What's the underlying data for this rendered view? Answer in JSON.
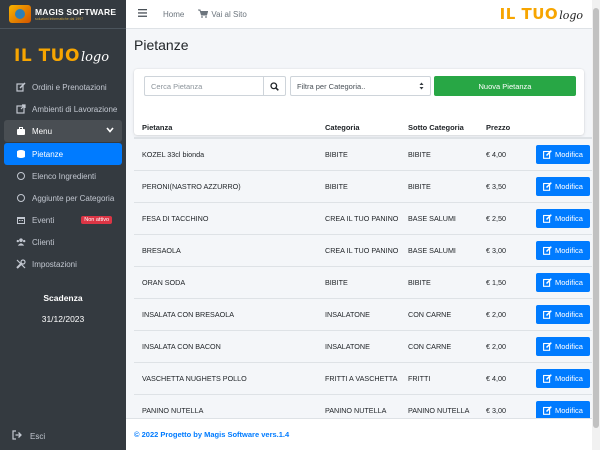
{
  "brand": {
    "title": "MAGIS SOFTWARE",
    "subtitle": "soluzioni informatiche dal 1997"
  },
  "logo": {
    "main": "IL TUO",
    "script": "logo"
  },
  "sidebar": {
    "items": [
      {
        "label": "Ordini e Prenotazioni",
        "icon": "edit-icon"
      },
      {
        "label": "Ambienti di Lavorazione",
        "icon": "external-link-icon"
      },
      {
        "label": "Menu",
        "icon": "briefcase-icon"
      },
      {
        "label": "Pietanze",
        "icon": "database-icon"
      },
      {
        "label": "Elenco Ingredienti",
        "icon": "circle-icon"
      },
      {
        "label": "Aggiunte per Categoria",
        "icon": "circle-icon"
      },
      {
        "label": "Eventi",
        "icon": "calendar-icon",
        "badge": "Non attivo"
      },
      {
        "label": "Clienti",
        "icon": "users-icon"
      },
      {
        "label": "Impostazioni",
        "icon": "tools-icon"
      }
    ],
    "deadline_label": "Scadenza",
    "deadline_date": "31/12/2023",
    "logout_label": "Esci"
  },
  "header": {
    "home_label": "Home",
    "site_label": "Vai al Sito"
  },
  "page": {
    "title": "Pietanze",
    "search_placeholder": "Cerca Pietanza",
    "filter_label": "Filtra per Categoria..",
    "new_button": "Nuova Pietanza"
  },
  "table": {
    "headers": [
      "Pietanza",
      "Categoria",
      "Sotto Categoria",
      "Prezzo"
    ],
    "edit_label": "Modifica",
    "rows": [
      {
        "name": "KOZEL 33cl bionda",
        "category": "BIBITE",
        "subcategory": "BIBITE",
        "price": "€ 4,00"
      },
      {
        "name": "PERONI(NASTRO AZZURRO)",
        "category": "BIBITE",
        "subcategory": "BIBITE",
        "price": "€ 3,50"
      },
      {
        "name": "FESA DI TACCHINO",
        "category": "CREA IL TUO PANINO",
        "subcategory": "BASE SALUMI",
        "price": "€ 2,50"
      },
      {
        "name": "BRESAOLA",
        "category": "CREA IL TUO PANINO",
        "subcategory": "BASE SALUMI",
        "price": "€ 3,00"
      },
      {
        "name": "ORAN SODA",
        "category": "BIBITE",
        "subcategory": "BIBITE",
        "price": "€ 1,50"
      },
      {
        "name": "INSALATA CON BRESAOLA",
        "category": "INSALATONE",
        "subcategory": "CON CARNE",
        "price": "€ 2,00"
      },
      {
        "name": "INSALATA CON BACON",
        "category": "INSALATONE",
        "subcategory": "CON CARNE",
        "price": "€ 2,00"
      },
      {
        "name": "VASCHETTA NUGHETS POLLO",
        "category": "FRITTI A VASCHETTA",
        "subcategory": "FRITTI",
        "price": "€ 4,00"
      },
      {
        "name": "PANINO NUTELLA",
        "category": "PANINO NUTELLA",
        "subcategory": "PANINO NUTELLA",
        "price": "€ 3,00"
      }
    ]
  },
  "footer": {
    "text": "© 2022 Progetto by Magis Software",
    "version": "vers.1.4"
  }
}
